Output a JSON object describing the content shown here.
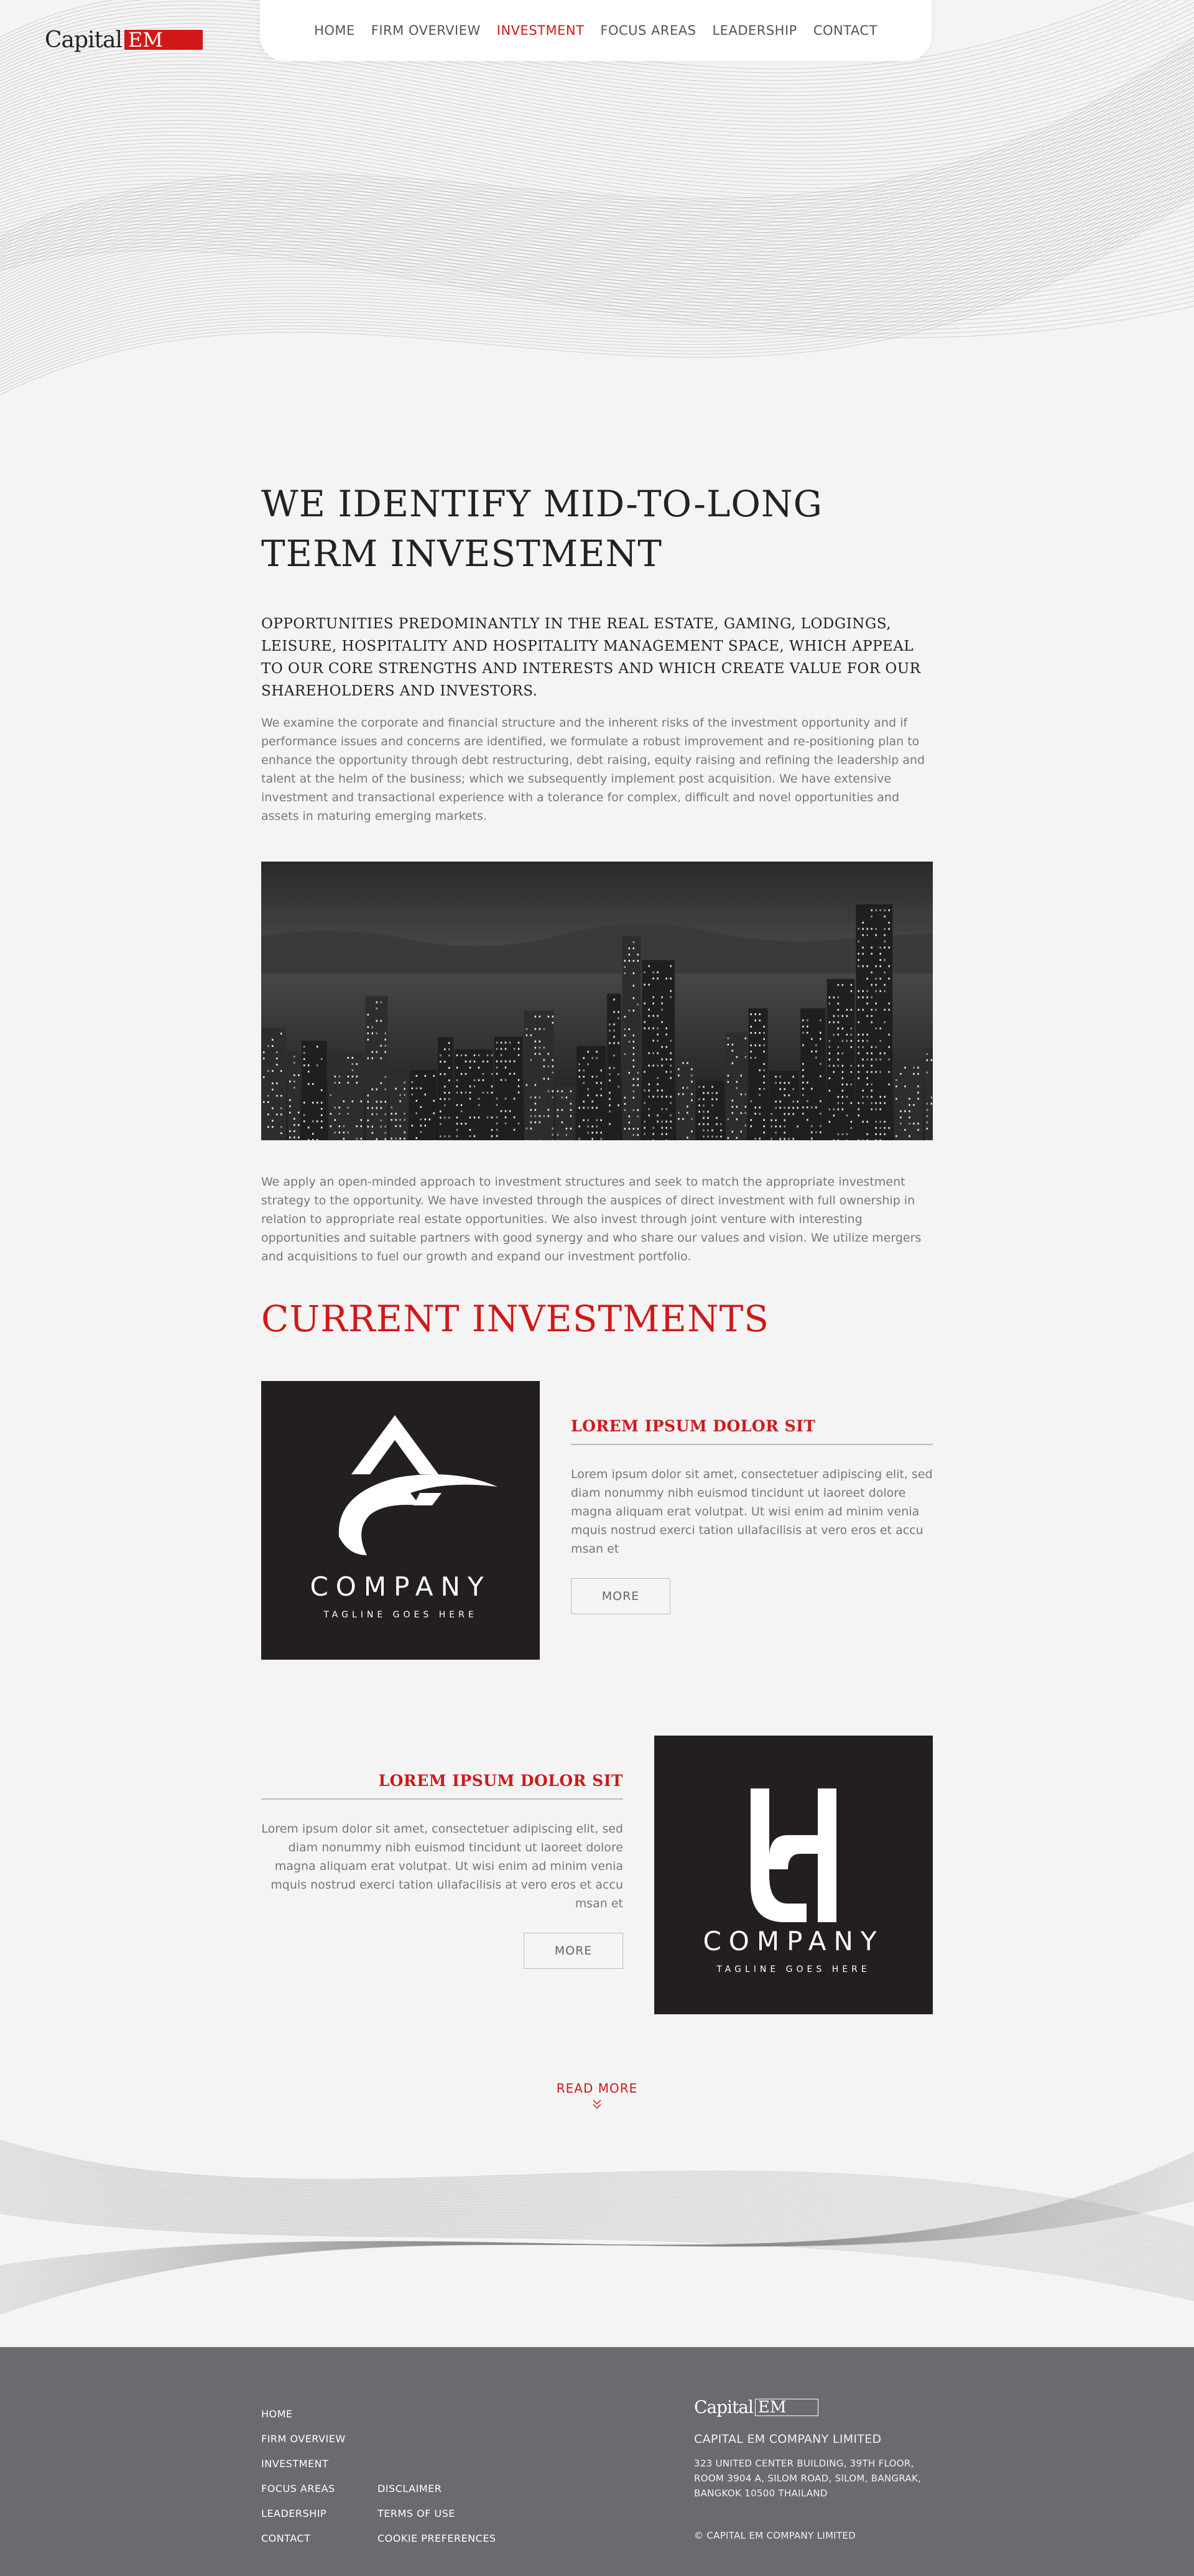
{
  "header": {
    "logo_text_1": "Capital",
    "logo_text_2": "EM",
    "nav": [
      {
        "label": "HOME"
      },
      {
        "label": "FIRM OVERVIEW"
      },
      {
        "label": "INVESTMENT",
        "active": true
      },
      {
        "label": "FOCUS AREAS"
      },
      {
        "label": "LEADERSHIP"
      },
      {
        "label": "CONTACT"
      }
    ]
  },
  "intro": {
    "title_line1": "WE IDENTIFY MID-TO-LONG",
    "title_line2": "TERM INVESTMENT",
    "lead": "OPPORTUNITIES PREDOMINANTLY IN THE REAL ESTATE, GAMING, LODGINGS, LEISURE, HOSPITALITY AND HOSPITALITY MANAGEMENT SPACE, WHICH APPEAL TO OUR CORE STRENGTHS AND INTERESTS AND WHICH CREATE VALUE FOR OUR SHAREHOLDERS AND INVESTORS.",
    "paragraph1": "We examine the corporate and financial structure and the inherent risks of the investment opportunity and if performance issues and concerns are identified, we formulate a robust improvement and re-positioning plan to enhance the opportunity through debt restructuring, debt raising, equity raising and refining the leadership and talent at the helm of the business; which we subsequently implement post acquisition. We have extensive investment and transactional experience with a tolerance for complex, difficult and novel opportunities and assets in maturing emerging markets.",
    "paragraph2": "We apply an open-minded approach to investment structures and seek to match the appropriate investment strategy to the opportunity. We have invested through the auspices of direct investment with full ownership in relation to appropriate real estate opportunities. We also invest through joint venture with interesting opportunities and suitable partners with good synergy and who share our values and vision. We utilize mergers and acquisitions to fuel our growth and expand our investment portfolio."
  },
  "investments": {
    "title": "CURRENT INVESTMENTS",
    "items": [
      {
        "heading": "LOREM IPSUM DOLOR SIT",
        "text": "Lorem ipsum dolor sit amet, consectetuer adipiscing elit, sed diam nonummy nibh euismod tincidunt ut laoreet dolore magna aliquam erat volutpat. Ut wisi enim ad minim venia mquis nostrud exerci tation ullafacilisis at vero eros et accu msan et",
        "button": "MORE",
        "logo_name": "COMPANY",
        "logo_tagline": "TAGLINE GOES HERE"
      },
      {
        "heading": "LOREM IPSUM DOLOR SIT",
        "text": "Lorem ipsum dolor sit amet, consectetuer adipiscing elit, sed diam nonummy nibh euismod tincidunt ut laoreet dolore magna aliquam erat volutpat. Ut wisi enim ad minim venia mquis nostrud exerci tation ullafacilisis at vero eros et accu msan et",
        "button": "MORE",
        "logo_name": "COMPANY",
        "logo_tagline": "TAGLINE GOES HERE"
      }
    ],
    "read_more": "READ MORE"
  },
  "footer": {
    "links_col1": [
      "HOME",
      "FIRM OVERVIEW",
      "INVESTMENT",
      "FOCUS AREAS",
      "LEADERSHIP",
      "CONTACT"
    ],
    "links_col2": [
      "DISCLAIMER",
      "TERMS OF USE",
      "COOKIE PREFERENCES"
    ],
    "logo_text_1": "Capital",
    "logo_text_2": "EM",
    "company": "CAPITAL EM COMPANY LIMITED",
    "address_line1": "323 UNITED CENTER BUILDING, 39TH FLOOR,",
    "address_line2": "ROOM 3904 A, SILOM ROAD, SILOM, BANGRAK,",
    "address_line3": "BANGKOK 10500 THAILAND",
    "copyright": "© CAPITAL EM COMPANY LIMITED"
  }
}
